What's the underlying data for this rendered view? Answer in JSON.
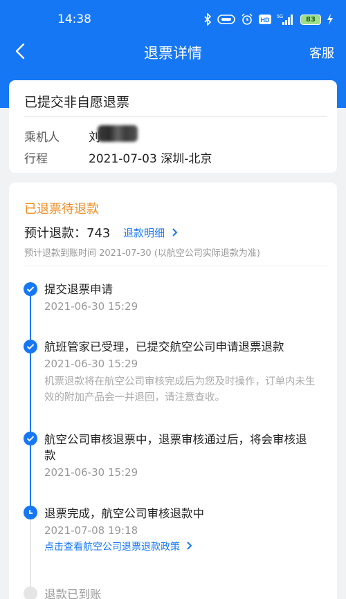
{
  "status_bar": {
    "time": "14:38",
    "icons": [
      "bluetooth-icon",
      "hd-call-icon",
      "alarm-icon",
      "hd-icon",
      "signal-5g-icon",
      "battery-icon",
      "charging-icon"
    ],
    "network": "5G",
    "battery": "83"
  },
  "nav": {
    "title": "退票详情",
    "service": "客服"
  },
  "summary": {
    "status_title": "已提交非自愿退票",
    "passenger_label": "乘机人",
    "passenger_name": "刘",
    "itinerary_label": "行程",
    "itinerary_value": "2021-07-03  深圳-北京"
  },
  "refund": {
    "status": "已退票待退款",
    "amount_text": "预计退款：743",
    "detail_link": "退款明细",
    "eta_text": "预计退款到账时间   2021-07-30 (以航空公司实际退款为准)"
  },
  "timeline": [
    {
      "title": "提交退票申请",
      "time": "2021-06-30 15:29",
      "state": "done"
    },
    {
      "title": "航班管家已受理，已提交航空公司申请退票退款",
      "time": "2021-06-30 15:29",
      "note": "机票退款将在航空公司审核完成后为您及时操作，订单内未生效的附加产品会一并退回，请注意查收。",
      "state": "done"
    },
    {
      "title": "航空公司审核退票中，退票审核通过后，将会审核退款",
      "time": "2021-06-30 15:29",
      "state": "done"
    },
    {
      "title": "退票完成，航空公司审核退款中",
      "time": "2021-07-08 19:18",
      "link": "点击查看航空公司退票退款政策",
      "state": "current"
    },
    {
      "title": "退款已到账",
      "state": "pending"
    }
  ],
  "colors": {
    "brand_blue": "#1677f5",
    "status_orange": "#f28b20",
    "page_bg": "#f1f2f4"
  }
}
